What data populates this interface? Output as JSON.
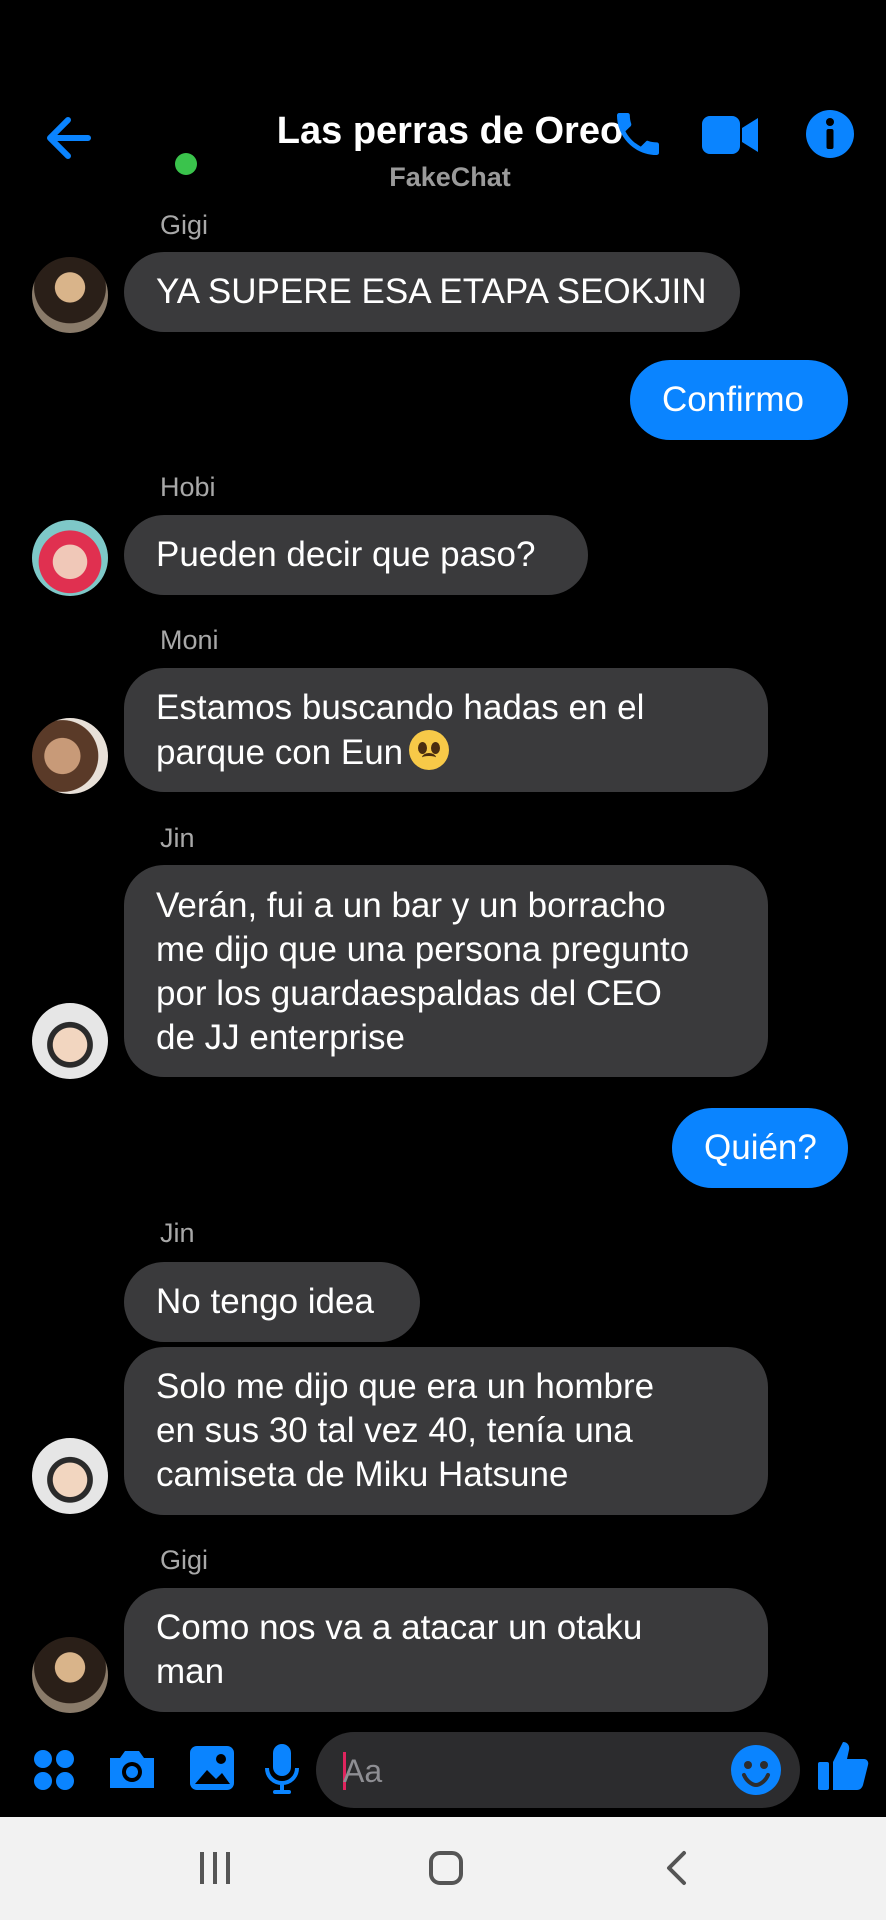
{
  "header": {
    "title": "Las perras de Oreo",
    "subtitle": "FakeChat"
  },
  "colors": {
    "accent": "#0a84ff",
    "bubble_other": "#3a3a3c",
    "online": "#3ac34c"
  },
  "icons": [
    "back-arrow-icon",
    "phone-icon",
    "video-camera-icon",
    "info-icon",
    "apps-icon",
    "camera-icon",
    "image-icon",
    "microphone-icon",
    "emoji-icon",
    "thumbs-up-icon"
  ],
  "messages": [
    {
      "sender": "Gigi",
      "text": "YA SUPERE ESA ETAPA SEOKJIN"
    },
    {
      "mine": true,
      "text": "Confirmo"
    },
    {
      "sender": "Hobi",
      "text": "Pueden decir que paso?"
    },
    {
      "sender": "Moni",
      "line1": "Estamos buscando hadas en el",
      "line2": "parque con Eun"
    },
    {
      "sender": "Jin",
      "line1": "Verán, fui a un bar y un borracho",
      "line2": "me dijo que una persona pregunto",
      "line3": "por los guardaespaldas del CEO",
      "line4": "de JJ enterprise"
    },
    {
      "mine": true,
      "text": "Quién?"
    },
    {
      "sender": "Jin",
      "text": "No tengo idea"
    },
    {
      "line1": "Solo me dijo que era un hombre",
      "line2": "en sus 30 tal vez 40, tenía una",
      "line3": "camiseta de Miku Hatsune"
    },
    {
      "sender": "Gigi",
      "line1": "Como nos va a atacar un otaku",
      "line2": "man"
    }
  ],
  "composer": {
    "placeholder": "Aa"
  }
}
